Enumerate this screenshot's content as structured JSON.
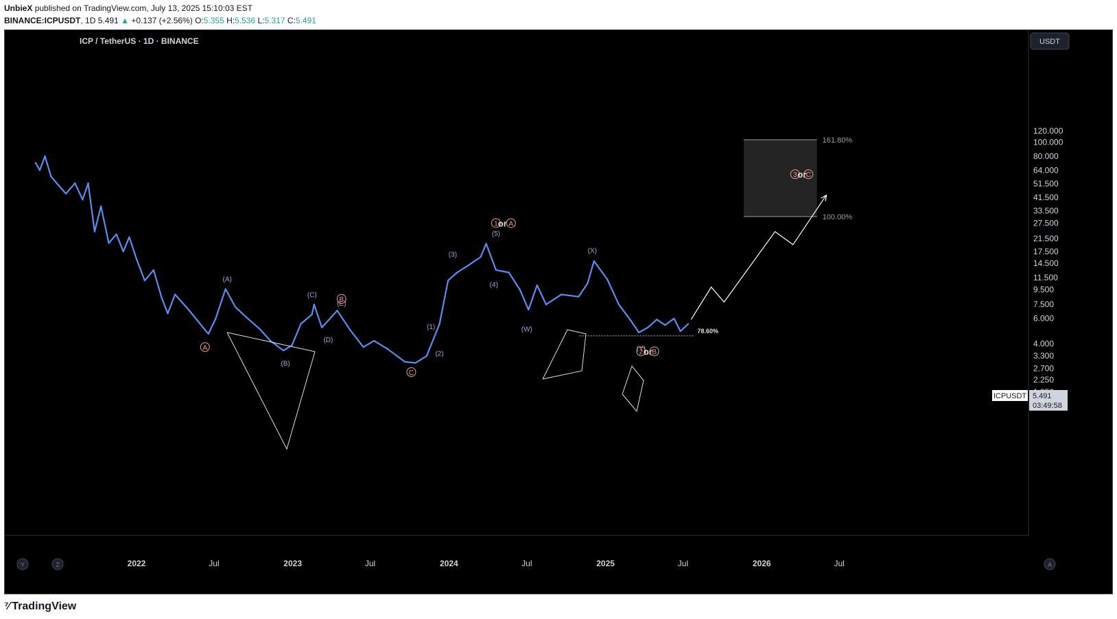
{
  "header": {
    "author": "UnbieX",
    "published": "published on TradingView.com, July 13, 2025 15:10:03 EST",
    "symbol": "BINANCE:ICPUSDT",
    "timeframe": "1D",
    "price": "5.491",
    "change": "+0.137 (+2.56%)",
    "o_label": "O:",
    "o_value": "5.355",
    "h_label": "H:",
    "h_value": "5.536",
    "l_label": "L:",
    "l_value": "5.317",
    "c_label": "C:",
    "c_value": "5.491"
  },
  "chart": {
    "legend": "ICP / TetherUS · 1D · BINANCE",
    "currency_button": "USDT",
    "price_tag_symbol": "ICPUSDT",
    "price_tag_price": "5.491",
    "price_tag_countdown": "03:49:58",
    "bottom_left_buttons": [
      "Y",
      "Z"
    ],
    "bottom_right_button": "A",
    "colors": {
      "background": "#000000",
      "candles": "#5b8def",
      "wave_labels": "#b39ddb",
      "circle_labels": "#ef9a9a",
      "annotation_lines": "#e0e0e0",
      "target_box": "#242424"
    }
  },
  "footer": {
    "brand": "TradingView"
  },
  "chart_data": {
    "type": "line",
    "title": "ICP / TetherUS · 1D · BINANCE",
    "y_scale": "log",
    "y_ticks": [
      "120.000",
      "100.000",
      "80.000",
      "64.000",
      "51.500",
      "41.500",
      "33.500",
      "27.500",
      "21.500",
      "17.500",
      "14.500",
      "11.500",
      "9.500",
      "7.500",
      "6.000",
      "4.000",
      "3.300",
      "2.700",
      "2.250",
      "1.850"
    ],
    "x_ticks": [
      "2022",
      "Jul",
      "2023",
      "Jul",
      "2024",
      "Jul",
      "2025",
      "Jul",
      "2026",
      "Jul"
    ],
    "x_tick_dates": [
      "2022-01-01",
      "2022-07-01",
      "2023-01-01",
      "2023-07-01",
      "2024-01-01",
      "2024-07-01",
      "2025-01-01",
      "2025-07-01",
      "2026-01-01",
      "2026-07-01"
    ],
    "series": [
      {
        "values": [
          {
            "date": "2021-05-10",
            "price": 72
          },
          {
            "date": "2021-05-20",
            "price": 64
          },
          {
            "date": "2021-06-01",
            "price": 80
          },
          {
            "date": "2021-06-15",
            "price": 58
          },
          {
            "date": "2021-07-01",
            "price": 51
          },
          {
            "date": "2021-07-20",
            "price": 44
          },
          {
            "date": "2021-08-10",
            "price": 52
          },
          {
            "date": "2021-08-28",
            "price": 40
          },
          {
            "date": "2021-09-10",
            "price": 52
          },
          {
            "date": "2021-09-25",
            "price": 24
          },
          {
            "date": "2021-10-10",
            "price": 36
          },
          {
            "date": "2021-10-28",
            "price": 20
          },
          {
            "date": "2021-11-15",
            "price": 23
          },
          {
            "date": "2021-12-01",
            "price": 17.5
          },
          {
            "date": "2021-12-15",
            "price": 22
          },
          {
            "date": "2022-01-01",
            "price": 15.5
          },
          {
            "date": "2022-01-20",
            "price": 11
          },
          {
            "date": "2022-02-10",
            "price": 13
          },
          {
            "date": "2022-03-01",
            "price": 8.3
          },
          {
            "date": "2022-03-15",
            "price": 6.5
          },
          {
            "date": "2022-04-01",
            "price": 8.8
          },
          {
            "date": "2022-05-01",
            "price": 7
          },
          {
            "date": "2022-06-10",
            "price": 5
          },
          {
            "date": "2022-06-18",
            "price": 4.7
          },
          {
            "date": "2022-07-05",
            "price": 6
          },
          {
            "date": "2022-07-28",
            "price": 9.6
          },
          {
            "date": "2022-08-20",
            "price": 7.2
          },
          {
            "date": "2022-09-15",
            "price": 6.1
          },
          {
            "date": "2022-10-15",
            "price": 5.1
          },
          {
            "date": "2022-11-10",
            "price": 4.2
          },
          {
            "date": "2022-12-10",
            "price": 3.6
          },
          {
            "date": "2022-12-30",
            "price": 3.9
          },
          {
            "date": "2023-01-20",
            "price": 5.5
          },
          {
            "date": "2023-02-15",
            "price": 6.4
          },
          {
            "date": "2023-02-20",
            "price": 7.5
          },
          {
            "date": "2023-03-10",
            "price": 5.2
          },
          {
            "date": "2023-04-15",
            "price": 6.8
          },
          {
            "date": "2023-05-15",
            "price": 5
          },
          {
            "date": "2023-06-15",
            "price": 3.8
          },
          {
            "date": "2023-07-10",
            "price": 4.2
          },
          {
            "date": "2023-08-10",
            "price": 3.7
          },
          {
            "date": "2023-09-20",
            "price": 3
          },
          {
            "date": "2023-10-15",
            "price": 2.95
          },
          {
            "date": "2023-11-10",
            "price": 3.3
          },
          {
            "date": "2023-12-10",
            "price": 5.5
          },
          {
            "date": "2023-12-30",
            "price": 11
          },
          {
            "date": "2024-01-20",
            "price": 12.5
          },
          {
            "date": "2024-02-15",
            "price": 14
          },
          {
            "date": "2024-03-15",
            "price": 16
          },
          {
            "date": "2024-03-28",
            "price": 19.8
          },
          {
            "date": "2024-04-20",
            "price": 13
          },
          {
            "date": "2024-05-20",
            "price": 12.5
          },
          {
            "date": "2024-06-15",
            "price": 9.5
          },
          {
            "date": "2024-07-05",
            "price": 6.9
          },
          {
            "date": "2024-07-25",
            "price": 10.2
          },
          {
            "date": "2024-08-15",
            "price": 7.5
          },
          {
            "date": "2024-09-20",
            "price": 8.8
          },
          {
            "date": "2024-10-30",
            "price": 8.5
          },
          {
            "date": "2024-11-20",
            "price": 10.5
          },
          {
            "date": "2024-12-05",
            "price": 15
          },
          {
            "date": "2025-01-05",
            "price": 11.2
          },
          {
            "date": "2025-02-01",
            "price": 7.5
          },
          {
            "date": "2025-03-01",
            "price": 5.8
          },
          {
            "date": "2025-03-20",
            "price": 4.8
          },
          {
            "date": "2025-04-10",
            "price": 5.2
          },
          {
            "date": "2025-05-01",
            "price": 5.9
          },
          {
            "date": "2025-05-20",
            "price": 5.4
          },
          {
            "date": "2025-06-10",
            "price": 6
          },
          {
            "date": "2025-06-25",
            "price": 4.9
          },
          {
            "date": "2025-07-13",
            "price": 5.491
          }
        ]
      }
    ],
    "target_zone": {
      "start": "2025-11-20",
      "end": "2026-05-10",
      "low": 30.5,
      "high": 104,
      "low_label": "100.00%",
      "high_label": "161.80%"
    },
    "fib_level": {
      "label": "78.60%",
      "price": 4.55,
      "start": "2024-11-01",
      "end": "2025-07-25"
    },
    "projection": [
      {
        "date": "2025-07-20",
        "price": 5.9
      },
      {
        "date": "2025-09-05",
        "price": 9.9
      },
      {
        "date": "2025-10-05",
        "price": 7.8
      },
      {
        "date": "2026-02-01",
        "price": 24
      },
      {
        "date": "2026-03-15",
        "price": 19.5
      },
      {
        "date": "2026-06-01",
        "price": 43
      }
    ],
    "annotations": [
      {
        "label": "(A)",
        "kind": "wave",
        "date": "2022-08-01",
        "price": 11.3
      },
      {
        "label": "(B)",
        "kind": "wave",
        "date": "2022-12-15",
        "price": 2.95
      },
      {
        "label": "(C)",
        "kind": "wave",
        "date": "2023-02-15",
        "price": 8.8
      },
      {
        "label": "(D)",
        "kind": "wave",
        "date": "2023-03-25",
        "price": 4.3
      },
      {
        "label": "(E)",
        "kind": "wave",
        "date": "2023-04-25",
        "price": 7.7
      },
      {
        "label": "(1)",
        "kind": "wave",
        "date": "2023-11-20",
        "price": 5.3
      },
      {
        "label": "(2)",
        "kind": "wave",
        "date": "2023-12-10",
        "price": 3.45
      },
      {
        "label": "(3)",
        "kind": "wave",
        "date": "2024-01-10",
        "price": 16.8
      },
      {
        "label": "(4)",
        "kind": "wave",
        "date": "2024-04-15",
        "price": 10.4
      },
      {
        "label": "(5)",
        "kind": "wave",
        "date": "2024-04-20",
        "price": 23.5
      },
      {
        "label": "(W)",
        "kind": "wave",
        "date": "2024-07-01",
        "price": 5.1
      },
      {
        "label": "(X)",
        "kind": "wave",
        "date": "2024-12-01",
        "price": 17.8
      },
      {
        "label": "(Y)",
        "kind": "wave",
        "date": "2025-03-25",
        "price": 3.75
      },
      {
        "label": "A",
        "kind": "circle",
        "date": "2022-06-10",
        "price": 3.8
      },
      {
        "label": "B",
        "kind": "circle",
        "date": "2023-04-25",
        "price": 8.2
      },
      {
        "label": "C",
        "kind": "circle",
        "date": "2023-10-05",
        "price": 2.55
      },
      {
        "label": "1",
        "kind": "circle",
        "date": "2024-04-20",
        "price": 27.5
      },
      {
        "label": "or",
        "kind": "text",
        "date": "2024-05-05",
        "price": 27.5
      },
      {
        "label": "A",
        "kind": "circle",
        "date": "2024-05-25",
        "price": 27.5
      },
      {
        "label": "2",
        "kind": "circle",
        "date": "2025-03-25",
        "price": 3.55
      },
      {
        "label": "or",
        "kind": "text",
        "date": "2025-04-10",
        "price": 3.55
      },
      {
        "label": "B",
        "kind": "circle",
        "date": "2025-04-25",
        "price": 3.55
      },
      {
        "label": "3",
        "kind": "circle",
        "date": "2026-03-20",
        "price": 60
      },
      {
        "label": "or",
        "kind": "text",
        "date": "2026-04-05",
        "price": 60
      },
      {
        "label": "C",
        "kind": "circle",
        "date": "2026-04-20",
        "price": 60
      }
    ]
  }
}
